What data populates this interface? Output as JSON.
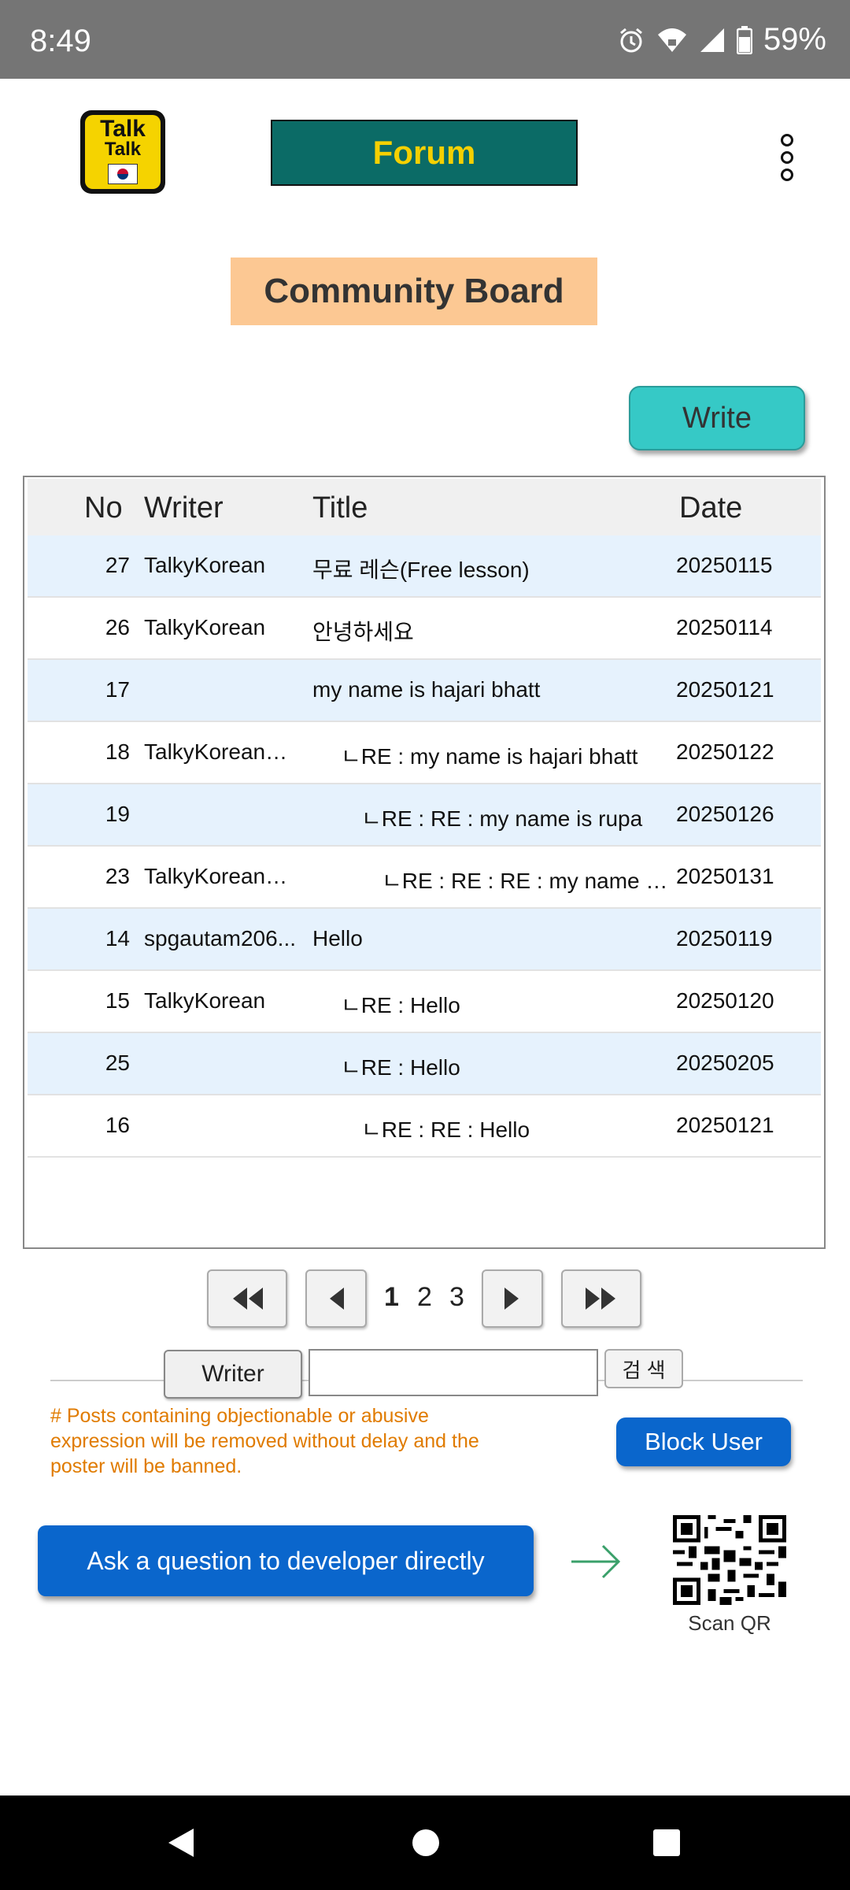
{
  "status_bar": {
    "time": "8:49",
    "battery": "59%"
  },
  "header": {
    "logo_line1": "Talk",
    "logo_line2": "Talk",
    "forum_label": "Forum"
  },
  "board": {
    "title": "Community Board",
    "write_label": "Write"
  },
  "table": {
    "headers": {
      "no": "No",
      "writer": "Writer",
      "title": "Title",
      "date": "Date"
    },
    "rows": [
      {
        "no": "27",
        "writer": "TalkyKorean",
        "title": "무료 레슨(Free lesson)",
        "date": "20250115",
        "depth": 0
      },
      {
        "no": "26",
        "writer": "TalkyKorean",
        "title": "안녕하세요",
        "date": "20250114",
        "depth": 0
      },
      {
        "no": "17",
        "writer": "",
        "title": "my name is hajari bhatt",
        "date": "20250121",
        "depth": 0
      },
      {
        "no": "18",
        "writer": "TalkyKorean@...",
        "title": "ㄴRE :  my name is hajari bhatt",
        "date": "20250122",
        "depth": 1
      },
      {
        "no": "19",
        "writer": "",
        "title": "ㄴRE :  RE :  my name is rupa",
        "date": "20250126",
        "depth": 2
      },
      {
        "no": "23",
        "writer": "TalkyKorean@...",
        "title": "ㄴRE :  RE :  RE :  my name is...",
        "date": "20250131",
        "depth": 3
      },
      {
        "no": "14",
        "writer": "spgautam206...",
        "title": "Hello",
        "date": "20250119",
        "depth": 0
      },
      {
        "no": "15",
        "writer": "TalkyKorean",
        "title": "ㄴRE :  Hello",
        "date": "20250120",
        "depth": 1
      },
      {
        "no": "25",
        "writer": "",
        "title": "ㄴRE :  Hello",
        "date": "20250205",
        "depth": 1
      },
      {
        "no": "16",
        "writer": "",
        "title": "ㄴRE :  RE :  Hello",
        "date": "20250121",
        "depth": 2
      }
    ]
  },
  "pagination": {
    "pages": [
      "1",
      "2",
      "3"
    ],
    "current": "1"
  },
  "search": {
    "field_label": "Writer",
    "value": "",
    "button_label": "검 색"
  },
  "notice": "# Posts containing objectionable or abusive expression will be removed without delay and the poster will be banned.",
  "block_user_label": "Block User",
  "ask_developer_label": "Ask a question to developer directly",
  "scan_qr_label": "Scan QR",
  "colors": {
    "forum_bg": "#0b6b66",
    "forum_text": "#f5d000",
    "title_bg": "#fcc893",
    "write_bg": "#36c9c6",
    "primary_blue": "#0a66cc",
    "row_shade": "#e6f2fd",
    "notice_text": "#e07b00"
  }
}
